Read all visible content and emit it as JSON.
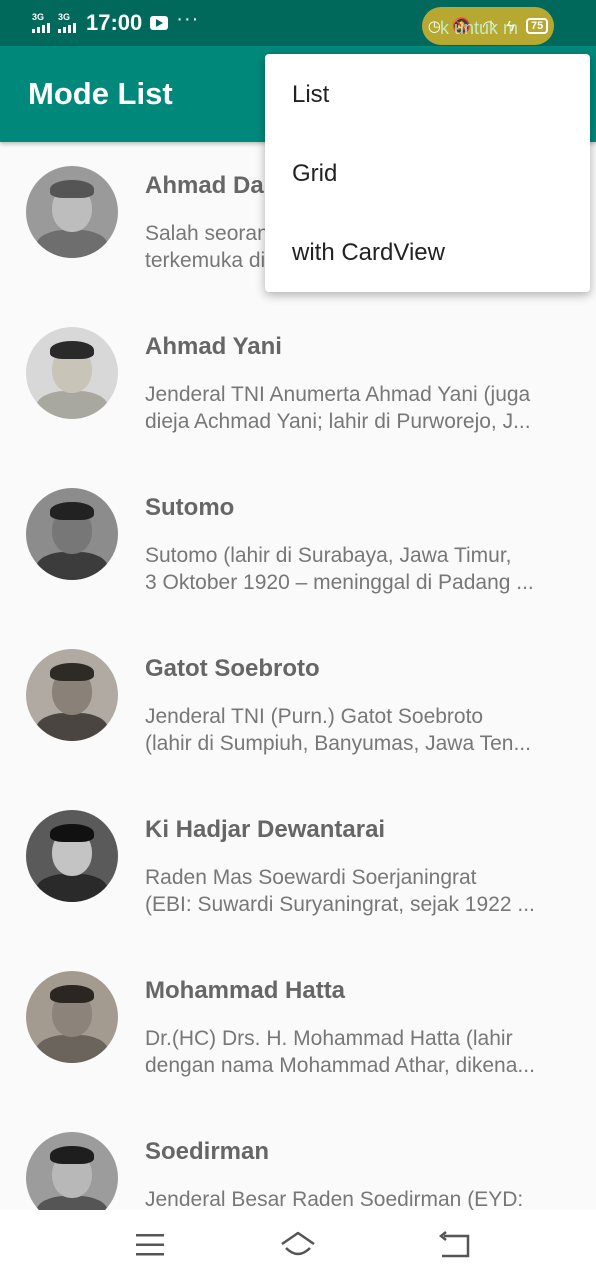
{
  "status_bar": {
    "network_1": "3G",
    "network_2": "3G",
    "time": "17:00",
    "more": "···",
    "battery": "75",
    "overlay_text": "k untuk m"
  },
  "app_bar": {
    "title": "Mode List"
  },
  "menu": {
    "items": [
      "List",
      "Grid",
      "with CardView"
    ]
  },
  "heroes": [
    {
      "name": "Ahmad Dahlan",
      "desc_line1": "Salah seorang ulama dan khatib",
      "desc_line2": "terkemuka di Masjid Besar..."
    },
    {
      "name": "Ahmad Yani",
      "desc_line1": "Jenderal TNI Anumerta Ahmad Yani (juga",
      "desc_line2": "dieja Achmad Yani; lahir di Purworejo, J..."
    },
    {
      "name": "Sutomo",
      "desc_line1": "Sutomo (lahir di Surabaya, Jawa Timur,",
      "desc_line2": "3 Oktober 1920 – meninggal di Padang ..."
    },
    {
      "name": "Gatot Soebroto",
      "desc_line1": "Jenderal TNI (Purn.) Gatot Soebroto",
      "desc_line2": "(lahir di Sumpiuh, Banyumas, Jawa Ten..."
    },
    {
      "name": "Ki Hadjar Dewantarai",
      "desc_line1": "Raden Mas Soewardi Soerjaningrat",
      "desc_line2": "(EBI: Suwardi Suryaningrat, sejak 1922 ..."
    },
    {
      "name": "Mohammad Hatta",
      "desc_line1": "Dr.(HC) Drs. H. Mohammad Hatta (lahir",
      "desc_line2": "dengan nama Mohammad Athar, dikena..."
    },
    {
      "name": "Soedirman",
      "desc_line1": "Jenderal Besar Raden Soedirman (EYD:",
      "desc_line2": ""
    }
  ],
  "icons": {
    "nav_menu": "menu-icon",
    "nav_home": "home-icon",
    "nav_back": "back-icon"
  },
  "colors": {
    "status_bar": "#00695c",
    "app_bar": "#00897b",
    "background": "#fafafa"
  }
}
